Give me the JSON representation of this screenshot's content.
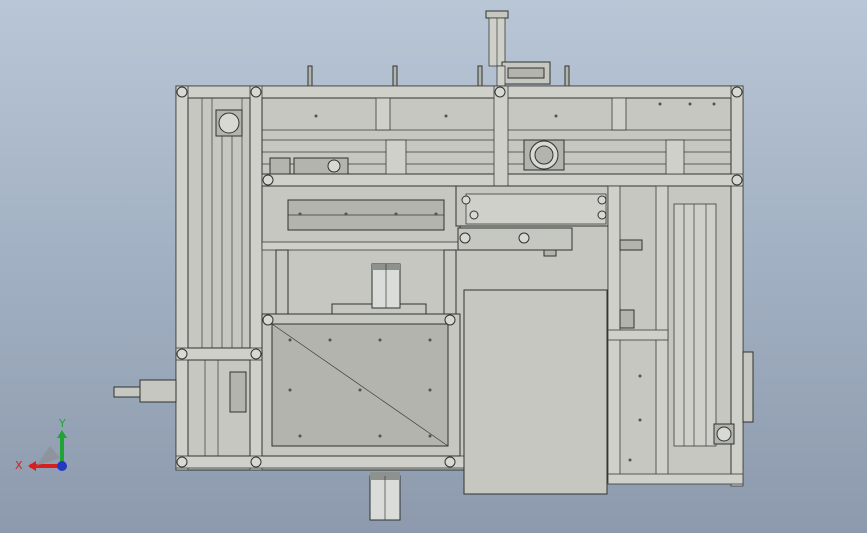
{
  "triad": {
    "x_label": "X",
    "y_label": "Y",
    "x_color": "#d42020",
    "y_color": "#21a335",
    "z_color": "#2438c4"
  },
  "colors": {
    "background_top": "#b9c6d6",
    "background_bottom": "#8d9aad",
    "part_fill": "#c6c7c1",
    "edge": "#2f3330"
  }
}
